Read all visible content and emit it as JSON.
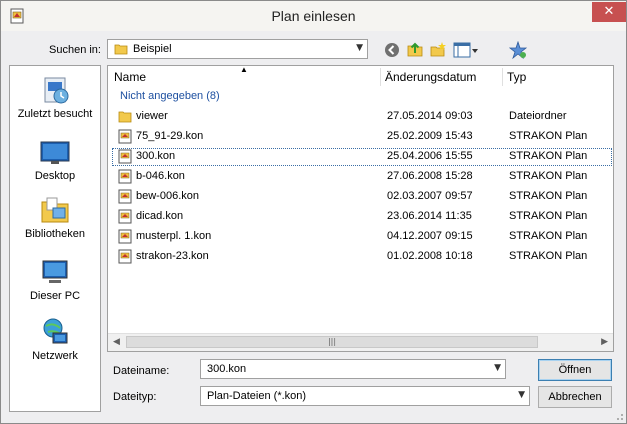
{
  "window": {
    "title": "Plan einlesen",
    "close_label": "✕"
  },
  "toolbar": {
    "look_in_label": "Suchen in:",
    "look_in_value": "Beispiel"
  },
  "places": [
    {
      "label": "Zuletzt besucht",
      "icon": "recent-places-icon"
    },
    {
      "label": "Desktop",
      "icon": "desktop-icon"
    },
    {
      "label": "Bibliotheken",
      "icon": "libraries-icon"
    },
    {
      "label": "Dieser PC",
      "icon": "this-pc-icon"
    },
    {
      "label": "Netzwerk",
      "icon": "network-icon"
    }
  ],
  "columns": {
    "name": "Name",
    "date": "Änderungsdatum",
    "type": "Typ"
  },
  "group_label": "Nicht angegeben (8)",
  "files": [
    {
      "name": "viewer",
      "date": "27.05.2014 09:03",
      "type": "Dateiordner",
      "kind": "folder"
    },
    {
      "name": "75_91-29.kon",
      "date": "25.02.2009 15:43",
      "type": "STRAKON Plan",
      "kind": "kon"
    },
    {
      "name": "300.kon",
      "date": "25.04.2006 15:55",
      "type": "STRAKON Plan",
      "kind": "kon",
      "selected": true
    },
    {
      "name": "b-046.kon",
      "date": "27.06.2008 15:28",
      "type": "STRAKON Plan",
      "kind": "kon"
    },
    {
      "name": "bew-006.kon",
      "date": "02.03.2007 09:57",
      "type": "STRAKON Plan",
      "kind": "kon"
    },
    {
      "name": "dicad.kon",
      "date": "23.06.2014 11:35",
      "type": "STRAKON Plan",
      "kind": "kon"
    },
    {
      "name": "musterpl. 1.kon",
      "date": "04.12.2007 09:15",
      "type": "STRAKON Plan",
      "kind": "kon"
    },
    {
      "name": "strakon-23.kon",
      "date": "01.02.2008 10:18",
      "type": "STRAKON Plan",
      "kind": "kon"
    }
  ],
  "form": {
    "filename_label": "Dateiname:",
    "filename_value": "300.kon",
    "filetype_label": "Dateityp:",
    "filetype_value": "Plan-Dateien (*.kon)"
  },
  "buttons": {
    "open": "Öffnen",
    "cancel": "Abbrechen"
  },
  "colors": {
    "accent": "#3c7fb1",
    "group_text": "#1e50a0",
    "close_button": "#c75050"
  }
}
